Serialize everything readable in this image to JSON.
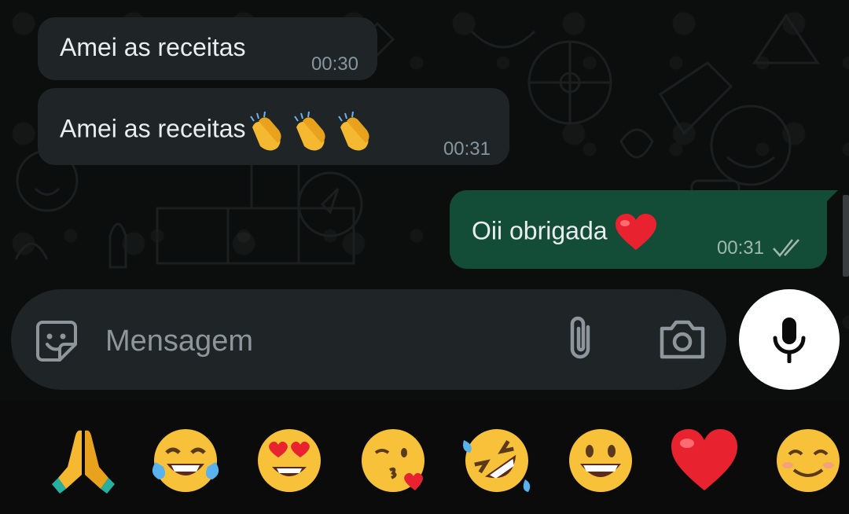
{
  "messages": [
    {
      "direction": "incoming",
      "text": "Amei as receitas",
      "time": "00:30"
    },
    {
      "direction": "incoming",
      "text": "Amei as receitas",
      "emoji": "clapping-hands x3",
      "time": "00:31"
    },
    {
      "direction": "outgoing",
      "text": "Oii obrigada",
      "emoji": "red-heart",
      "time": "00:31",
      "status": "read"
    }
  ],
  "composer": {
    "placeholder": "Mensagem",
    "value": "",
    "icons": [
      "sticker-icon",
      "attach-icon",
      "camera-icon"
    ]
  },
  "mic_button": {
    "icon": "microphone-icon"
  },
  "quick_emojis": [
    "folded-hands",
    "face-with-tears-of-joy",
    "smiling-face-with-heart-eyes",
    "face-blowing-a-kiss",
    "rolling-on-the-floor-laughing",
    "grinning-face",
    "red-heart",
    "smiling-face"
  ],
  "colors": {
    "background": "#0c0d0d",
    "incoming_bubble": "#1f2426",
    "outgoing_bubble": "#144d37",
    "text": "#e9edef",
    "meta": "#8696a0",
    "read_ticks": "#9fb8ad"
  }
}
